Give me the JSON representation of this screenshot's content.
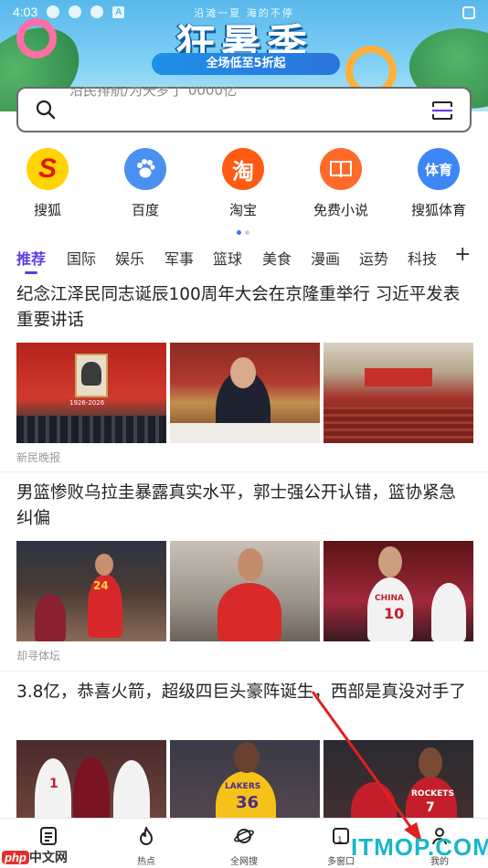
{
  "status_bar": {
    "time": "4:03",
    "indicator": "A"
  },
  "banner": {
    "top_text": "沿滩一夏 海的不停",
    "title": "狂暑季",
    "subtitle": "全场低至5折起"
  },
  "search": {
    "placeholder": "沿民排航/为天罗了 0000亿"
  },
  "apps": [
    {
      "label": "搜狐",
      "icon": "sohu-icon",
      "color": "#ffd400"
    },
    {
      "label": "百度",
      "icon": "baidu-paw-icon",
      "color": "#4a90f0"
    },
    {
      "label": "淘宝",
      "icon": "taobao-icon",
      "color": "#ff5a12"
    },
    {
      "label": "免费小说",
      "icon": "book-icon",
      "color": "#ff6a2b"
    },
    {
      "label": "搜狐体育",
      "icon": "sports-icon",
      "color": "#3d86f5"
    }
  ],
  "tabs": [
    "推荐",
    "国际",
    "娱乐",
    "军事",
    "篮球",
    "美食",
    "漫画",
    "运势",
    "科技"
  ],
  "tabs_plus": "+",
  "articles": [
    {
      "title": "纪念江泽民同志诞辰100周年大会在京隆重举行 习近平发表重要讲话",
      "source": "新民晚报",
      "portrait_caption": "1926-2026"
    },
    {
      "title": "男篮惨败乌拉圭暴露真实水平，郭士强公开认错，篮协紧急纠偏",
      "source": "却寻体坛"
    },
    {
      "title": "3.8亿，恭喜火箭，超级四巨头豪阵诞生，西部是真没对手了",
      "source": ""
    }
  ],
  "jerseys": {
    "a2": "24",
    "a3_team": "CHINA",
    "a3_num": "10",
    "b1": "1",
    "b2": "LAKERS",
    "b2_num": "36",
    "b3_team": "ROCKETS",
    "b3_num": "7"
  },
  "bottom_nav": [
    {
      "label": "",
      "icon": "news-icon"
    },
    {
      "label": "热点",
      "icon": "fire-icon"
    },
    {
      "label": "全网搜",
      "icon": "planet-icon"
    },
    {
      "label": "多窗口",
      "icon": "window-icon",
      "badge": "1"
    },
    {
      "label": "我的",
      "icon": "user-icon"
    }
  ],
  "watermarks": {
    "left_p": "php",
    "left_rest": "中文网",
    "right": "ITMOP.COM"
  },
  "colors": {
    "accent": "#5a3ee6",
    "annotation_arrow": "#e02020"
  }
}
